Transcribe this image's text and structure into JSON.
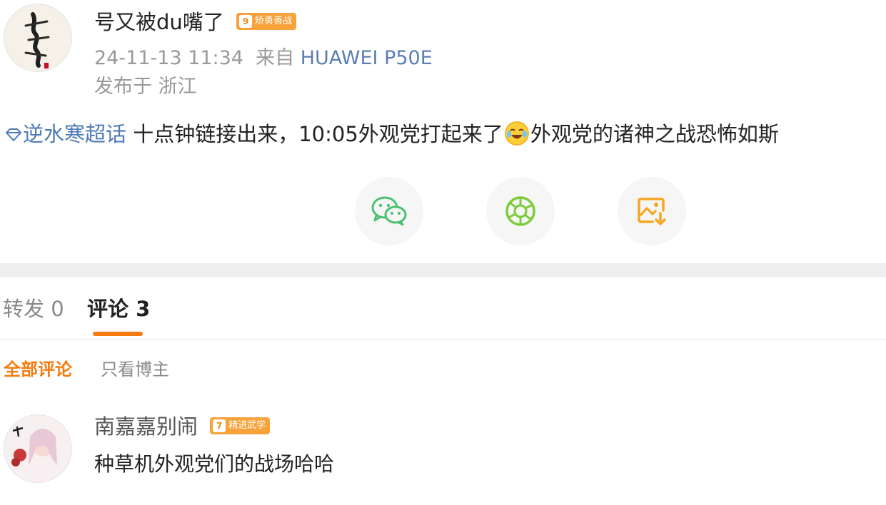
{
  "post": {
    "author": {
      "name": "号又被du嘴了",
      "badge_level": "9",
      "badge_label": "矫勇善战"
    },
    "timestamp": "24-11-13 11:34",
    "source_prefix": "来自",
    "device": "HUAWEI P50E",
    "location": "发布于 浙江",
    "topic": "逆水寒超话",
    "text_part1": "十点钟链接出来，10:05外观党打起来了",
    "text_part2": "外观党的诸神之战恐怖如斯"
  },
  "share": {
    "items": [
      "wechat-icon",
      "moments-icon",
      "save-image-icon"
    ],
    "colors": {
      "wechat": "#4cc070",
      "moments": "#7ccc3a",
      "save": "#f5a623"
    }
  },
  "tabs": {
    "repost": "转发 0",
    "comments": "评论 3"
  },
  "filters": {
    "all": "全部评论",
    "blogger_only": "只看博主"
  },
  "comments": [
    {
      "name": "南嘉嘉别闹",
      "badge_level": "7",
      "badge_label": "精进武学",
      "text": "种草机外观党们的战场哈哈"
    }
  ],
  "colors": {
    "accent": "#f77b0f",
    "link": "#4e7bb7",
    "badge": "#f7a23b"
  }
}
